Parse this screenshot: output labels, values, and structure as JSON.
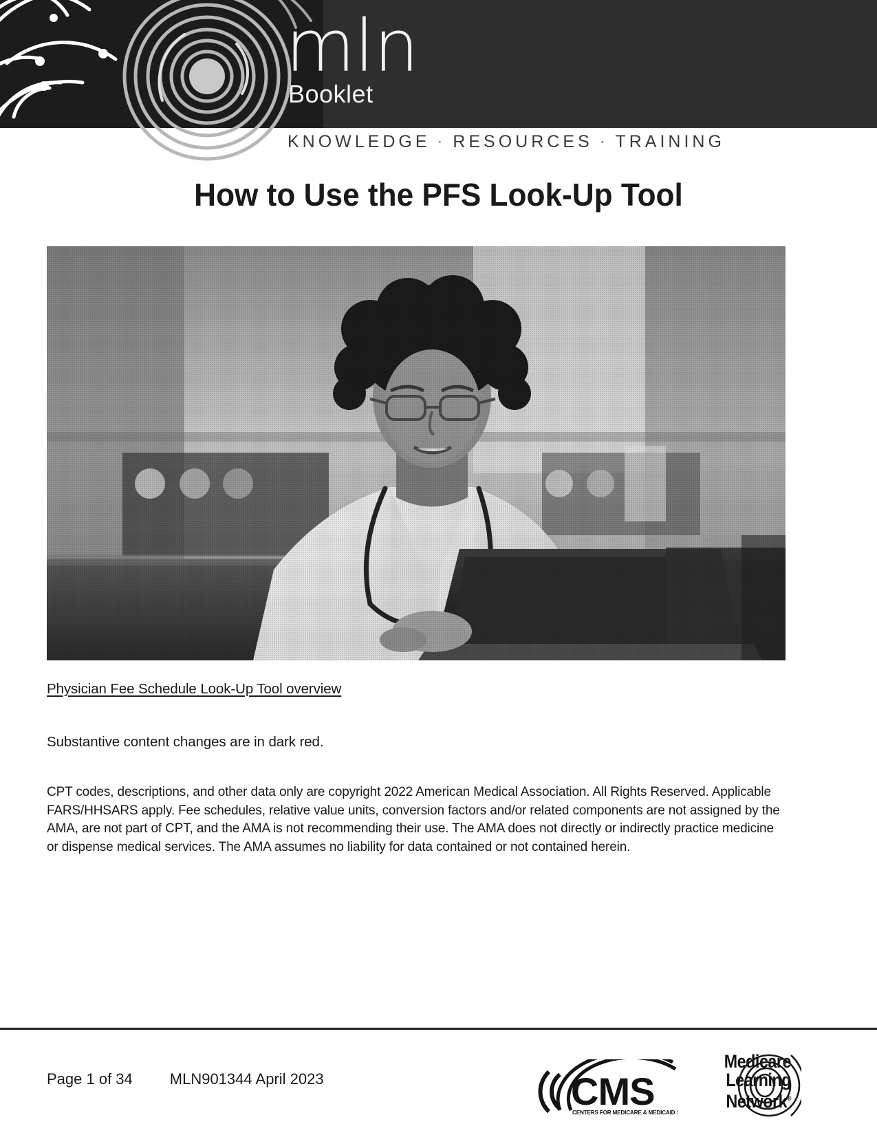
{
  "header": {
    "brand_mark": "mln",
    "brand_subtitle": "Booklet",
    "tagline_parts": [
      "KNOWLEDGE",
      "RESOURCES",
      "TRAINING"
    ],
    "tagline_separator": "·",
    "band_color": "#2e2e2e",
    "deco_block_color": "#1c1c1c"
  },
  "title": "How to Use the PFS Look-Up Tool",
  "hero_photo": {
    "alt": "Healthcare provider with stethoscope working at a laptop in a clinic",
    "style": "grayscale-halftone"
  },
  "body": {
    "overview_link": "Physician Fee Schedule Look-Up Tool overview",
    "notice": "Substantive content changes are in dark red.",
    "copyright": "CPT codes, descriptions, and other data only are copyright 2022 American Medical Association. All Rights Reserved. Applicable FARS/HHSARS apply. Fee schedules, relative value units, conversion factors and/or related components are not assigned by the AMA, are not part of CPT, and the AMA is not recommending their use. The AMA does not directly or indirectly practice medicine or dispense medical services. The AMA assumes no liability for data contained or not contained herein."
  },
  "footer": {
    "page_label": "Page 1 of 34",
    "document_id": "MLN901344 April 2023",
    "cms_logo": {
      "wordmark": "CMS",
      "subtext": "CENTERS FOR MEDICARE & MEDICAID SERVICES"
    },
    "mln_logo": {
      "line1": "Medicare",
      "line2": "Learning",
      "line3": "Network",
      "registered_mark": "®"
    }
  },
  "colors": {
    "text": "#1a1a1a",
    "header_band": "#2e2e2e",
    "rule": "#1f1f1f"
  }
}
